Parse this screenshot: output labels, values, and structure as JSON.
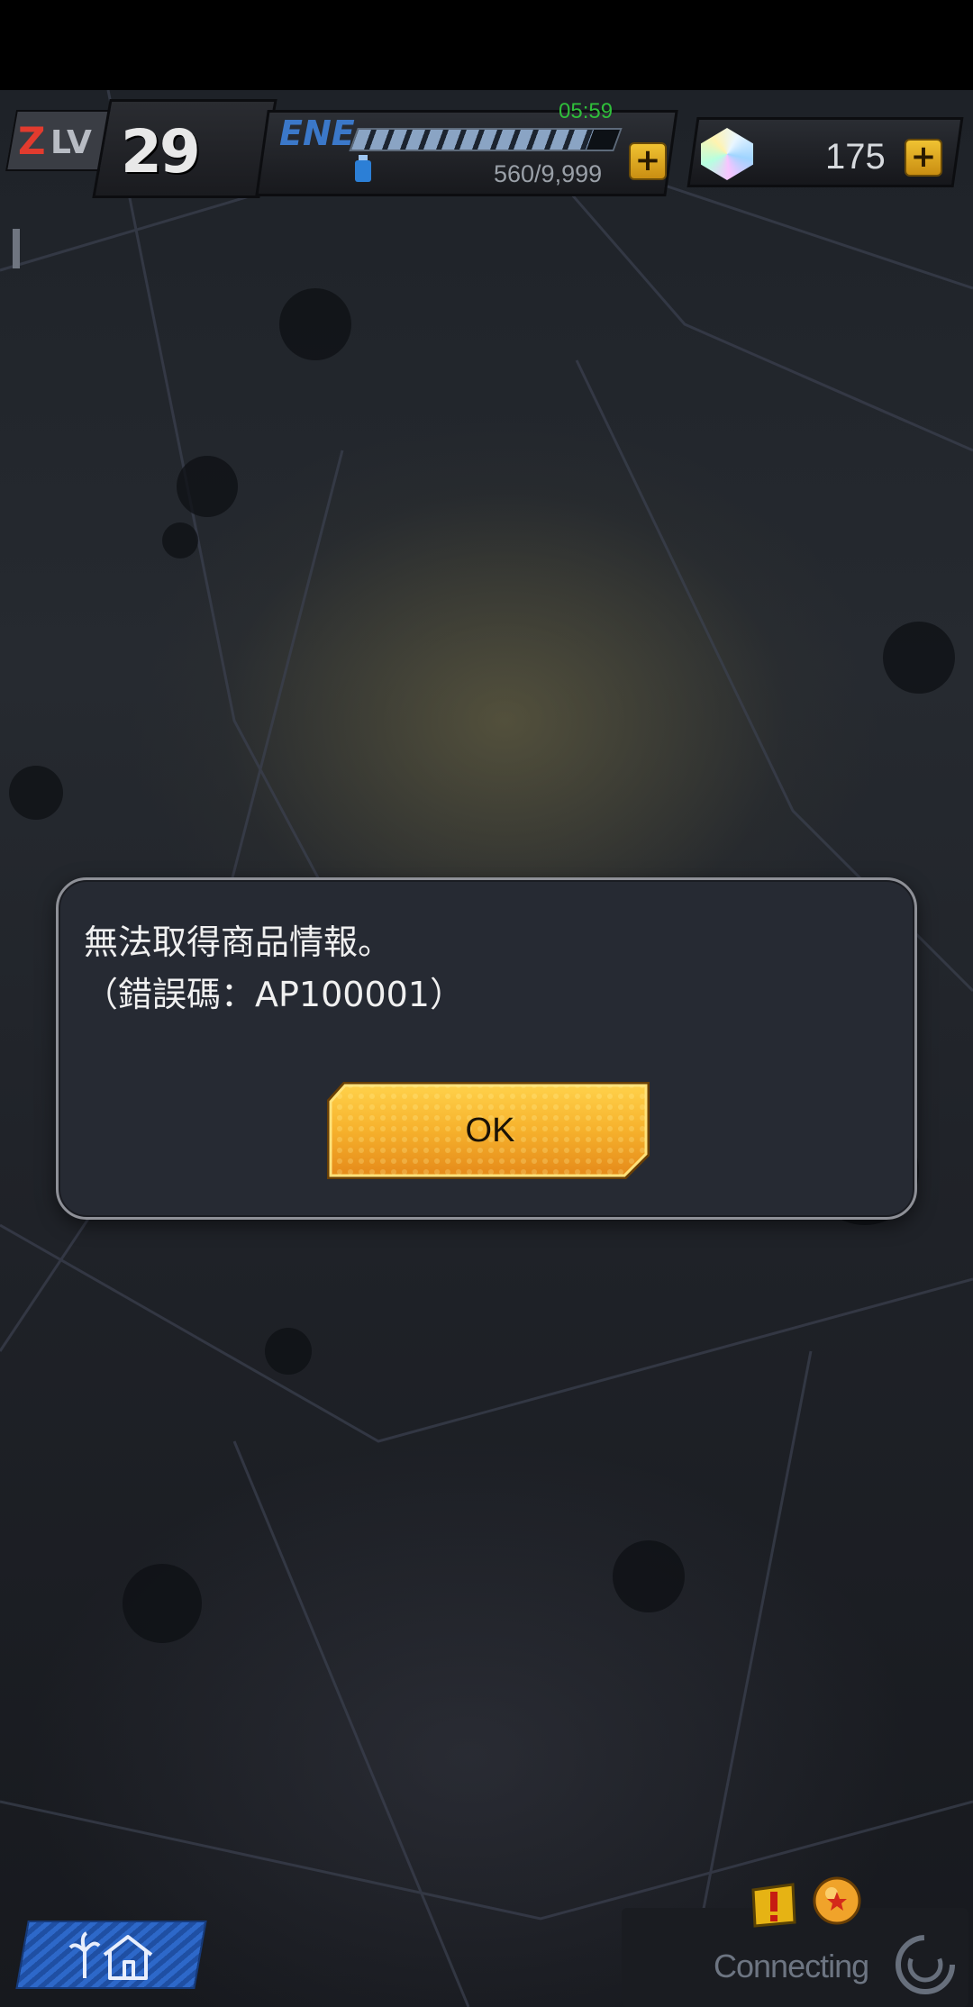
{
  "hud": {
    "level_prefix": "Z",
    "level_label": "LV",
    "level_value": "29",
    "energy_label": "ENE",
    "energy_timer": "05:59",
    "energy_count": "560/9,999",
    "energy_fraction": 0.9,
    "gem_count": "175",
    "plus_label": "+"
  },
  "dialog": {
    "message_line1": "無法取得商品情報。",
    "message_line2": "（錯誤碼：AP100001）",
    "ok_label": "OK"
  },
  "bottom": {
    "connecting_text": "Connecting"
  },
  "icons": {
    "home": "home-icon",
    "gem": "gem-icon",
    "energy": "energy-icon",
    "alert": "alert-icon",
    "dragonball": "dragonball-icon",
    "spinner": "spinner-icon"
  },
  "colors": {
    "dialog_bg": "#262a33",
    "ok_button": "#f0a524",
    "level_accent": "#e23b2e",
    "energy_accent": "#3b78c9",
    "timer_green": "#2fbf3a",
    "home_blue": "#2d68c9"
  }
}
